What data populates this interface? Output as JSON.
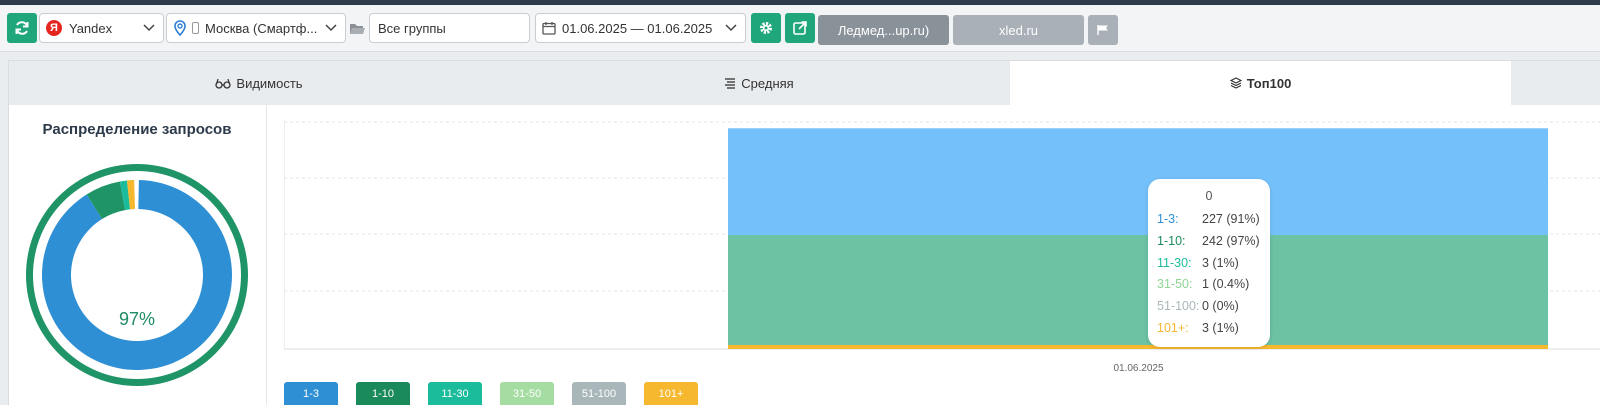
{
  "toolbar": {
    "search_engine": "Yandex",
    "region": "Москва (Смартф...",
    "group": "Все группы",
    "date_range": "01.06.2025 — 01.06.2025",
    "project1": "Ледмед...up.ru)",
    "project2": "xled.ru"
  },
  "tabs": [
    {
      "label": "Видимость",
      "icon": "glasses-icon"
    },
    {
      "label": "Средняя",
      "icon": "list-icon"
    },
    {
      "label": "Топ100",
      "icon": "layers-icon",
      "active": true
    }
  ],
  "donut": {
    "title": "Распределение запросов",
    "center_label": "97%"
  },
  "tooltip": {
    "title": "0",
    "rows": [
      {
        "key": "1-3:",
        "value": "227 (91%)",
        "color": "#2e8fd4"
      },
      {
        "key": "1-10:",
        "value": "242 (97%)",
        "color": "#1b8a5a"
      },
      {
        "key": "11-30:",
        "value": "3 (1%)",
        "color": "#1abc9c"
      },
      {
        "key": "31-50:",
        "value": "1 (0.4%)",
        "color": "#8fd694"
      },
      {
        "key": "51-100:",
        "value": "0 (0%)",
        "color": "#a9b7bb"
      },
      {
        "key": "101+:",
        "value": "3 (1%)",
        "color": "#f5b82e"
      }
    ]
  },
  "chart_data": {
    "type": "area",
    "x": [
      "01.06.2025"
    ],
    "series": [
      {
        "name": "1-3",
        "values": [
          227
        ],
        "color": "#74c0fa"
      },
      {
        "name": "1-10",
        "values": [
          242
        ],
        "color": "#6cc2a2"
      },
      {
        "name": "11-30",
        "values": [
          3
        ],
        "color": "#1abc9c"
      },
      {
        "name": "31-50",
        "values": [
          1
        ],
        "color": "#a5dca2"
      },
      {
        "name": "51-100",
        "values": [
          0
        ],
        "color": "#a9b7bb"
      },
      {
        "name": "101+",
        "values": [
          3
        ],
        "color": "#f5b82e"
      }
    ],
    "legend": [
      "1-3",
      "1-10",
      "11-30",
      "31-50",
      "51-100",
      "101+"
    ],
    "legend_colors": [
      "#2e8fd4",
      "#1b8a5a",
      "#1abc9c",
      "#a5dca2",
      "#a9b7bb",
      "#f5b82e"
    ],
    "grid": true,
    "legend_placement": "bottom"
  },
  "colors": {
    "accent_green": "#1fa67a",
    "donut_outer": "#1f9466",
    "donut_inner": "#2e8fd4"
  }
}
